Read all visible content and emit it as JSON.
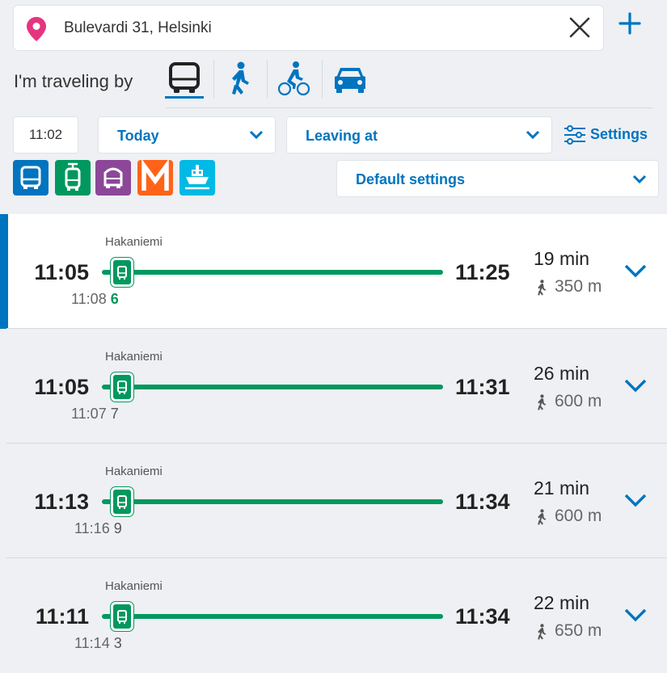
{
  "search": {
    "address": "Bulevardi 31, Helsinki"
  },
  "travel": {
    "label": "I'm traveling by",
    "modes": [
      "bus-icon",
      "walk-icon",
      "bike-icon",
      "car-icon"
    ],
    "selected": "bus"
  },
  "time": {
    "value": "11:02",
    "date": "Today",
    "departure_mode": "Leaving at",
    "settings_label": "Settings"
  },
  "transport_modes": [
    {
      "name": "bus",
      "color": "#0074bf"
    },
    {
      "name": "tram",
      "color": "#00985f"
    },
    {
      "name": "train",
      "color": "#8c4799"
    },
    {
      "name": "metro",
      "color": "#ff6319"
    },
    {
      "name": "ferry",
      "color": "#00b9e4"
    }
  ],
  "settings_dropdown": {
    "value": "Default settings"
  },
  "itineraries": [
    {
      "stop": "Hakaniemi",
      "depart": "11:05",
      "stop_time": "11:08",
      "route": "6",
      "arrive": "11:25",
      "duration": "19 min",
      "walk": "350 m",
      "selected": true
    },
    {
      "stop": "Hakaniemi",
      "depart": "11:05",
      "stop_time": "11:07",
      "route": "7",
      "arrive": "11:31",
      "duration": "26 min",
      "walk": "600 m",
      "selected": false
    },
    {
      "stop": "Hakaniemi",
      "depart": "11:13",
      "stop_time": "11:16",
      "route": "9",
      "arrive": "11:34",
      "duration": "21 min",
      "walk": "600 m",
      "selected": false
    },
    {
      "stop": "Hakaniemi",
      "depart": "11:11",
      "stop_time": "11:14",
      "route": "3",
      "arrive": "11:34",
      "duration": "22 min",
      "walk": "650 m",
      "selected": false
    }
  ]
}
